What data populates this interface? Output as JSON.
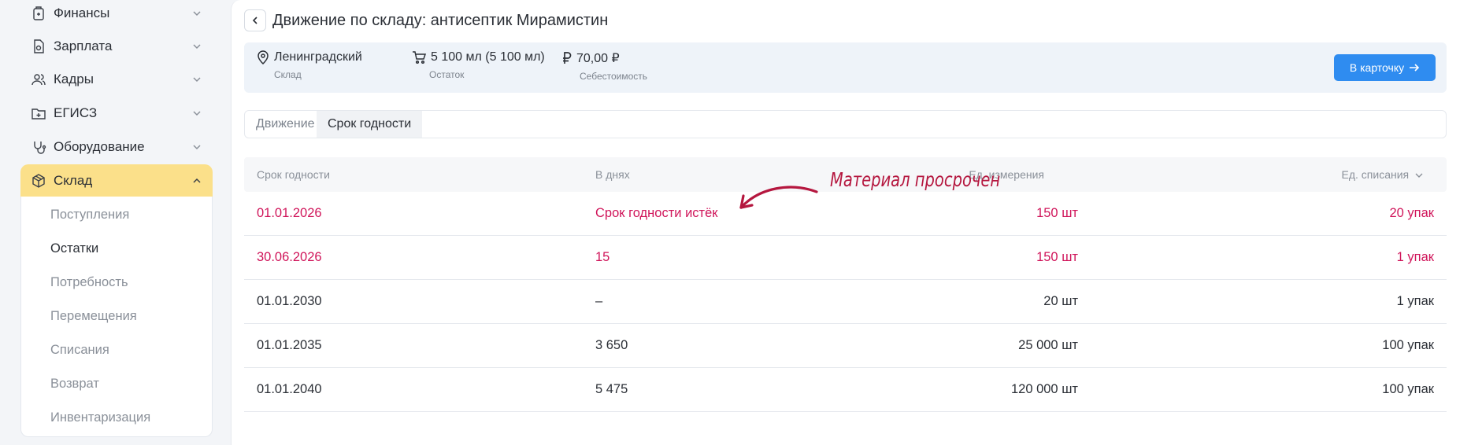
{
  "sidebar": {
    "items": [
      {
        "label": "Финансы",
        "icon": "wallet-icon"
      },
      {
        "label": "Зарплата",
        "icon": "money-doc-icon"
      },
      {
        "label": "Кадры",
        "icon": "users-icon"
      },
      {
        "label": "ЕГИСЗ",
        "icon": "medical-folder-icon"
      },
      {
        "label": "Оборудование",
        "icon": "stethoscope-icon"
      },
      {
        "label": "Склад",
        "icon": "box-icon"
      }
    ],
    "submenu": [
      "Поступления",
      "Остатки",
      "Потребность",
      "Перемещения",
      "Списания",
      "Возврат",
      "Инвентаризация"
    ]
  },
  "page": {
    "title": "Движение по складу: антисептик Мирамистин"
  },
  "info": {
    "warehouse_value": "Ленинградский",
    "warehouse_label": "Склад",
    "stock_value": "5 100 мл (5 100 мл)",
    "stock_label": "Остаток",
    "cost_value": "70,00 ₽",
    "cost_label": "Себестоимость",
    "card_button": "В карточку"
  },
  "tabs": [
    "Движение",
    "Срок годности"
  ],
  "table": {
    "headers": [
      "Срок годности",
      "В днях",
      "Ед. измерения",
      "Ед. списания"
    ],
    "rows": [
      {
        "date": "01.01.2026",
        "days": "Срок годности истёк",
        "unit": "150 шт",
        "writeoff": "20 упак",
        "expired": true
      },
      {
        "date": "30.06.2026",
        "days": "15",
        "unit": "150 шт",
        "writeoff": "1 упак",
        "expired": true
      },
      {
        "date": "01.01.2030",
        "days": "–",
        "unit": "20 шт",
        "writeoff": "1 упак",
        "expired": false
      },
      {
        "date": "01.01.2035",
        "days": "3 650",
        "unit": "25 000 шт",
        "writeoff": "100 упак",
        "expired": false
      },
      {
        "date": "01.01.2040",
        "days": "5 475",
        "unit": "120 000 шт",
        "writeoff": "100  упак",
        "expired": false
      }
    ]
  },
  "annotation": "Материал просрочен",
  "colors": {
    "accent": "#2f8cf0",
    "active_nav": "#fbe08a",
    "expired": "#d0155a",
    "annotation": "#b5173f"
  }
}
